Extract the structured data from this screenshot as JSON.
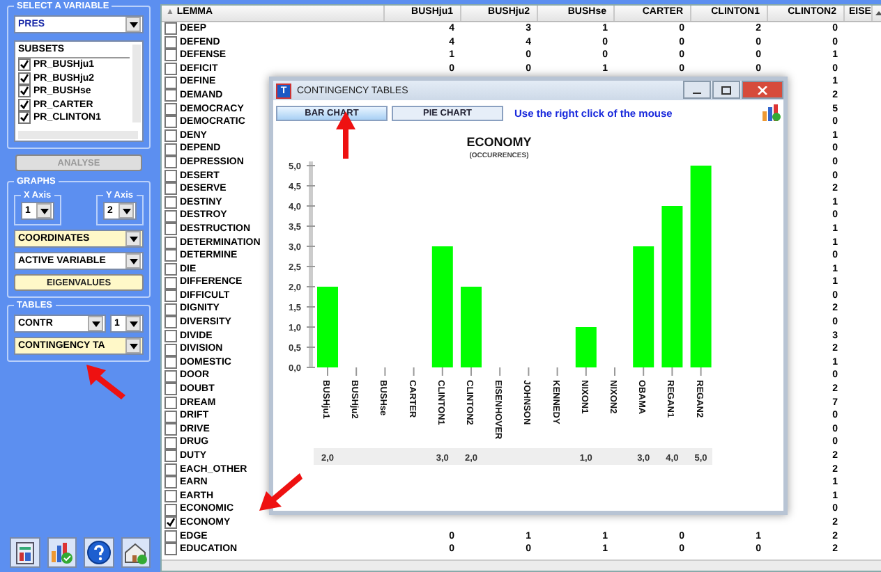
{
  "left_panel": {
    "select_variable": {
      "legend": "SELECT A VARIABLE",
      "variable": "PRES",
      "subsets_header": "SUBSETS",
      "subsets": [
        {
          "label": "PR_BUSHju1",
          "checked": true
        },
        {
          "label": "PR_BUSHju2",
          "checked": true
        },
        {
          "label": "PR_BUSHse",
          "checked": true
        },
        {
          "label": "PR_CARTER",
          "checked": true
        },
        {
          "label": "PR_CLINTON1",
          "checked": true
        }
      ]
    },
    "analyse_button": {
      "label": "ANALYSE",
      "disabled": true
    },
    "graphs": {
      "legend": "GRAPHS",
      "x_axis_label": "X Axis",
      "x_axis": "1",
      "y_axis_label": "Y Axis",
      "y_axis": "2",
      "plot": "COORDINATES",
      "variables": "ACTIVE VARIABLE",
      "eigenvalues_button": "EIGENVALUES"
    },
    "tables": {
      "legend": "TABLES",
      "measure": "CONTR",
      "axis": "1",
      "table": "CONTINGENCY TA"
    }
  },
  "table": {
    "sort_icon": "▲",
    "columns": [
      "LEMMA",
      "BUSHju1",
      "BUSHju2",
      "BUSHse",
      "CARTER",
      "CLINTON1",
      "CLINTON2",
      "EISE"
    ],
    "rows": [
      {
        "label": "DEEP",
        "checked": false,
        "values": [
          "4",
          "3",
          "1",
          "0",
          "2",
          "0"
        ]
      },
      {
        "label": "DEFEND",
        "checked": false,
        "values": [
          "4",
          "4",
          "0",
          "0",
          "0",
          "0"
        ]
      },
      {
        "label": "DEFENSE",
        "checked": false,
        "values": [
          "1",
          "0",
          "0",
          "0",
          "0",
          "1"
        ]
      },
      {
        "label": "DEFICIT",
        "checked": false,
        "values": [
          "0",
          "0",
          "1",
          "0",
          "0",
          "0"
        ]
      },
      {
        "label": "DEFINE",
        "checked": false,
        "values": [
          "1"
        ]
      },
      {
        "label": "DEMAND",
        "checked": false,
        "values": [
          "2"
        ]
      },
      {
        "label": "DEMOCRACY",
        "checked": false,
        "values": [
          "5"
        ]
      },
      {
        "label": "DEMOCRATIC",
        "checked": false,
        "values": [
          "0"
        ]
      },
      {
        "label": "DENY",
        "checked": false,
        "values": [
          "1"
        ]
      },
      {
        "label": "DEPEND",
        "checked": false,
        "values": [
          "0"
        ]
      },
      {
        "label": "DEPRESSION",
        "checked": false,
        "values": [
          "0"
        ]
      },
      {
        "label": "DESERT",
        "checked": false,
        "values": [
          "0"
        ]
      },
      {
        "label": "DESERVE",
        "checked": false,
        "values": [
          "2"
        ]
      },
      {
        "label": "DESTINY",
        "checked": false,
        "values": [
          "1"
        ]
      },
      {
        "label": "DESTROY",
        "checked": false,
        "values": [
          "0"
        ]
      },
      {
        "label": "DESTRUCTION",
        "checked": false,
        "values": [
          "1"
        ]
      },
      {
        "label": "DETERMINATION",
        "checked": false,
        "values": [
          "1"
        ]
      },
      {
        "label": "DETERMINE",
        "checked": false,
        "values": [
          "0"
        ]
      },
      {
        "label": "DIE",
        "checked": false,
        "values": [
          "1"
        ]
      },
      {
        "label": "DIFFERENCE",
        "checked": false,
        "values": [
          "1"
        ]
      },
      {
        "label": "DIFFICULT",
        "checked": false,
        "values": [
          "0"
        ]
      },
      {
        "label": "DIGNITY",
        "checked": false,
        "values": [
          "2"
        ]
      },
      {
        "label": "DIVERSITY",
        "checked": false,
        "values": [
          "0"
        ]
      },
      {
        "label": "DIVIDE",
        "checked": false,
        "values": [
          "3"
        ]
      },
      {
        "label": "DIVISION",
        "checked": false,
        "values": [
          "2"
        ]
      },
      {
        "label": "DOMESTIC",
        "checked": false,
        "values": [
          "1"
        ]
      },
      {
        "label": "DOOR",
        "checked": false,
        "values": [
          "0"
        ]
      },
      {
        "label": "DOUBT",
        "checked": false,
        "values": [
          "2"
        ]
      },
      {
        "label": "DREAM",
        "checked": false,
        "values": [
          "7"
        ]
      },
      {
        "label": "DRIFT",
        "checked": false,
        "values": [
          "0"
        ]
      },
      {
        "label": "DRIVE",
        "checked": false,
        "values": [
          "0"
        ]
      },
      {
        "label": "DRUG",
        "checked": false,
        "values": [
          "0"
        ]
      },
      {
        "label": "DUTY",
        "checked": false,
        "values": [
          "2"
        ]
      },
      {
        "label": "EACH_OTHER",
        "checked": false,
        "values": [
          "2"
        ]
      },
      {
        "label": "EARN",
        "checked": false,
        "values": [
          "1"
        ]
      },
      {
        "label": "EARTH",
        "checked": false,
        "values": [
          "1"
        ]
      },
      {
        "label": "ECONOMIC",
        "checked": false,
        "values": [
          "0"
        ]
      },
      {
        "label": "ECONOMY",
        "checked": true,
        "values": [
          "2"
        ]
      },
      {
        "label": "EDGE",
        "checked": false,
        "values": [
          "0",
          "1",
          "1",
          "0",
          "1",
          "2"
        ]
      },
      {
        "label": "EDUCATION",
        "checked": false,
        "values": [
          "0",
          "0",
          "1",
          "0",
          "0",
          "2"
        ]
      }
    ]
  },
  "dialog": {
    "title": "CONTINGENCY TABLES",
    "app_icon": "T",
    "tabs": [
      {
        "label": "BAR CHART",
        "selected": true
      },
      {
        "label": "PIE CHART",
        "selected": false
      }
    ],
    "hint": "Use the right click of the mouse",
    "chart_data": {
      "type": "bar",
      "title": "ECONOMY",
      "subtitle": "(OCCURRENCES)",
      "categories": [
        "BUSHju1",
        "BUSHju2",
        "BUSHse",
        "CARTER",
        "CLINTON1",
        "CLINTON2",
        "EISENHOVER",
        "JOHNSON",
        "KENNEDY",
        "NIXON1",
        "NIXON2",
        "OBAMA",
        "REGAN1",
        "REGAN2"
      ],
      "series": [
        {
          "color": "#00ff00",
          "values": [
            2,
            null,
            null,
            null,
            3,
            2,
            null,
            null,
            null,
            1,
            null,
            3,
            4,
            5
          ]
        }
      ],
      "ylim": [
        0,
        5
      ],
      "yticks": [
        {
          "value": 0,
          "label": "0,0"
        },
        {
          "value": 0.5,
          "label": "0,5"
        },
        {
          "value": 1,
          "label": "1,0"
        },
        {
          "value": 1.5,
          "label": "1,5"
        },
        {
          "value": 2,
          "label": "2,0"
        },
        {
          "value": 2.5,
          "label": "2,5"
        },
        {
          "value": 3,
          "label": "3,0"
        },
        {
          "value": 3.5,
          "label": "3,5"
        },
        {
          "value": 4,
          "label": "4,0"
        },
        {
          "value": 4.5,
          "label": "4,5"
        },
        {
          "value": 5,
          "label": "5,0"
        }
      ],
      "value_labels": [
        "2,0",
        null,
        null,
        null,
        "3,0",
        "2,0",
        null,
        null,
        null,
        "1,0",
        null,
        "3,0",
        "4,0",
        "5,0"
      ]
    }
  }
}
